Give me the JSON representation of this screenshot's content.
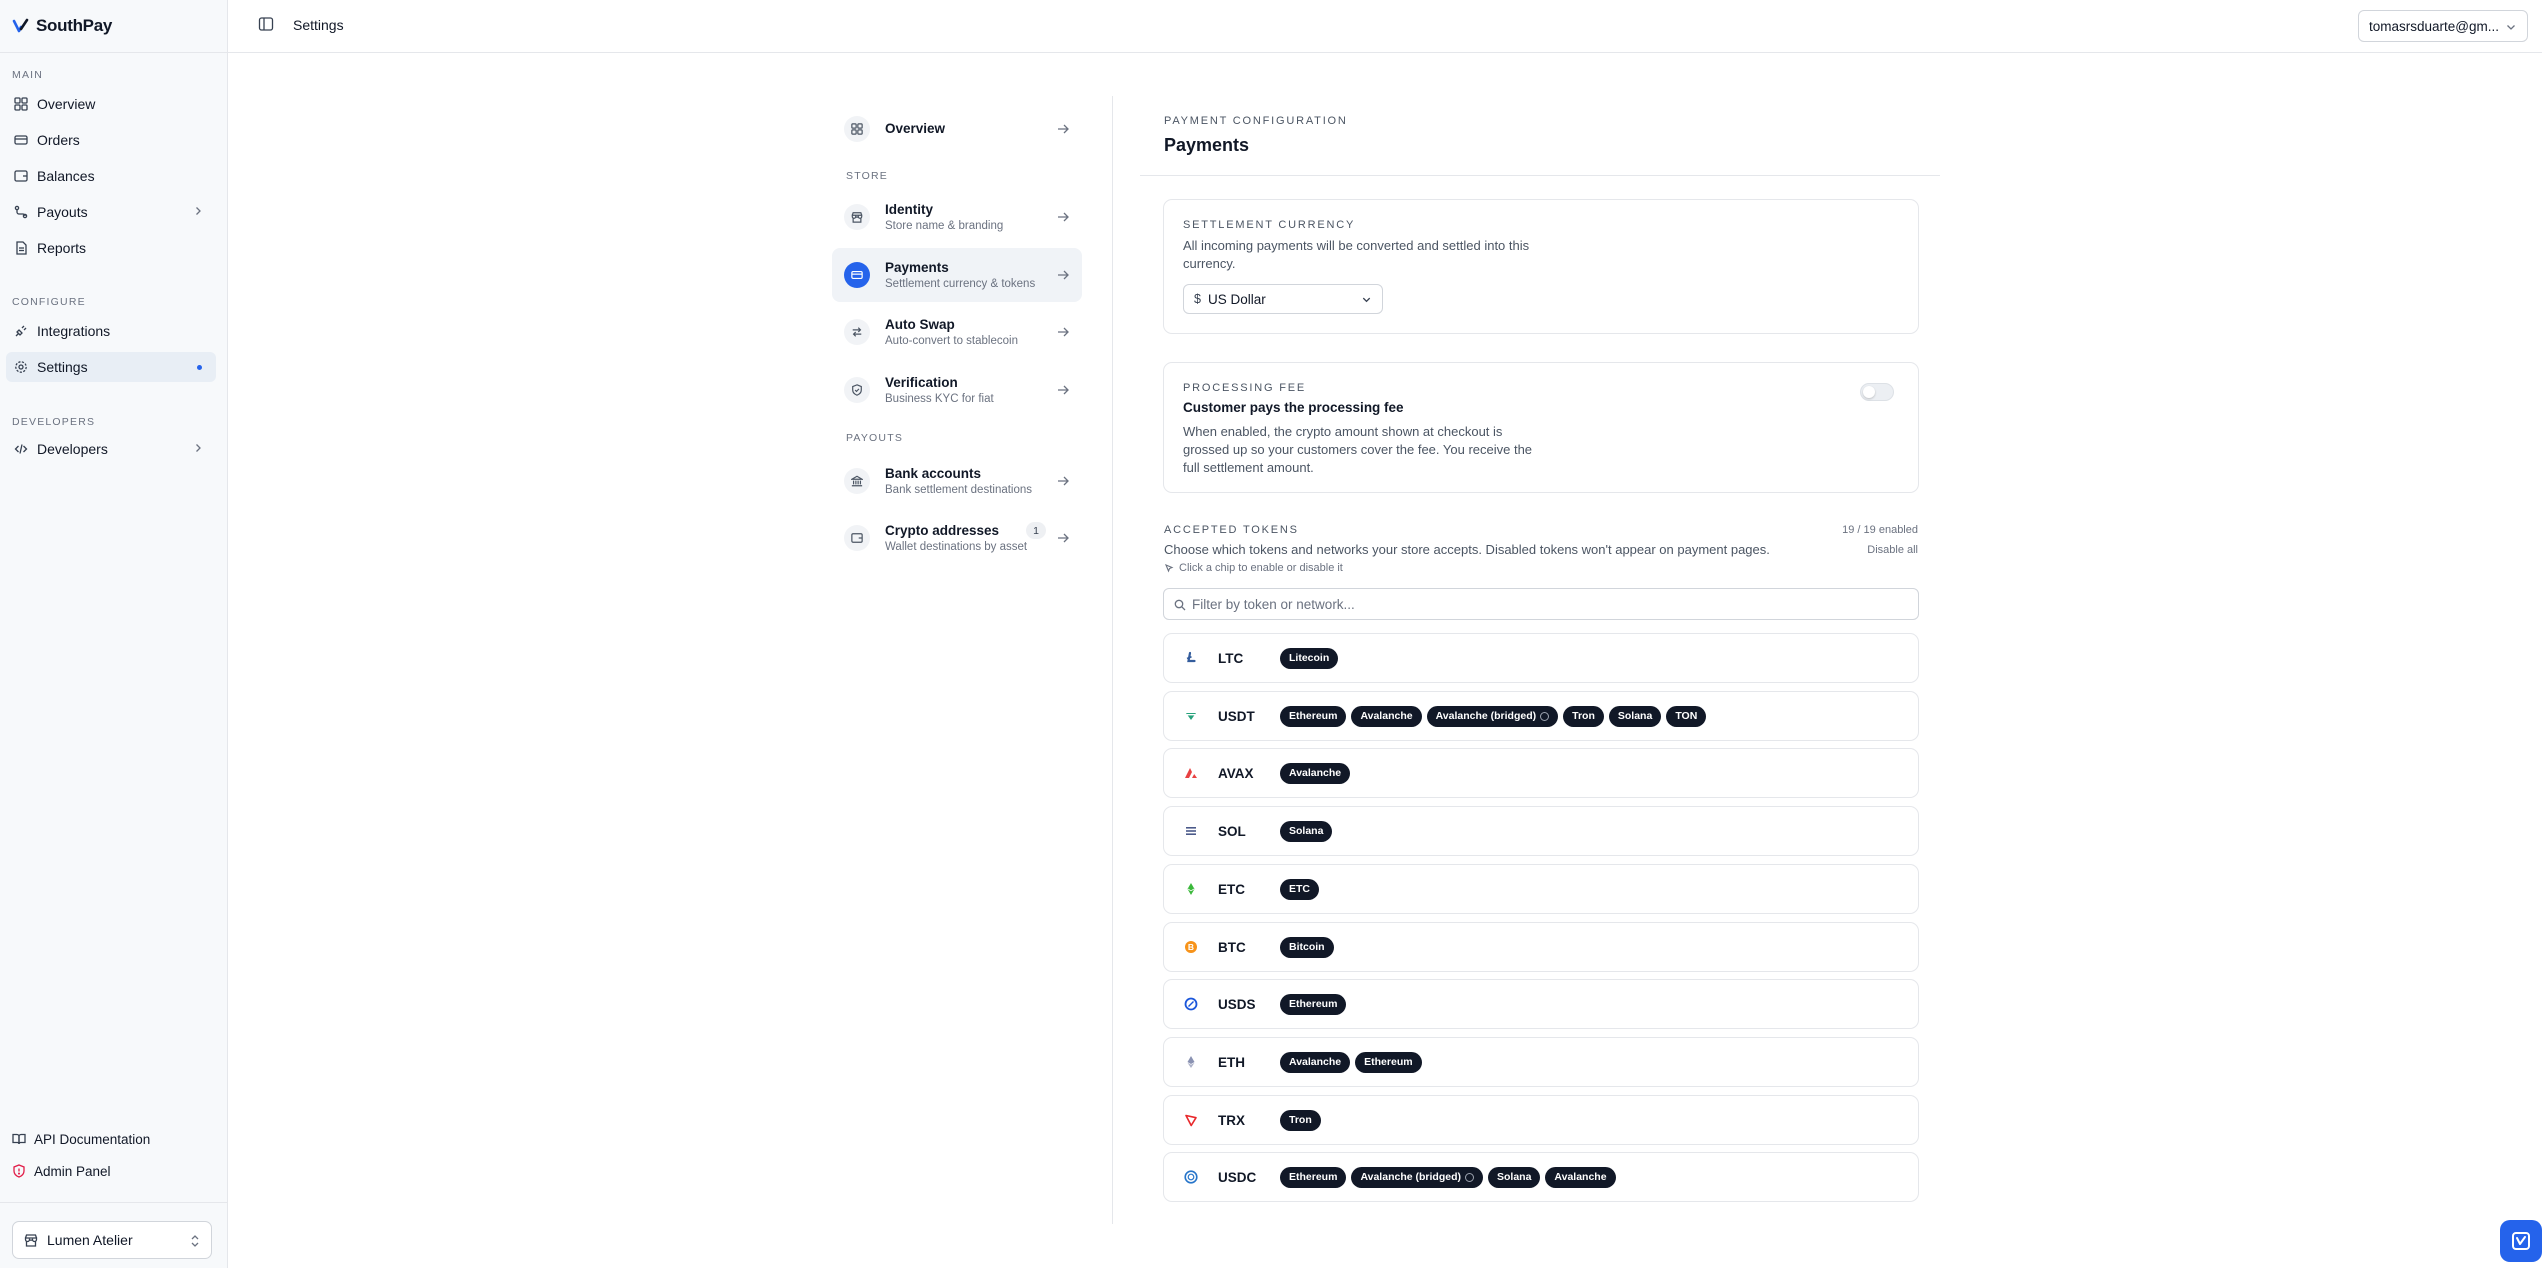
{
  "brand": {
    "name": "SouthPay"
  },
  "sidebar": {
    "sections": {
      "main": "MAIN",
      "configure": "CONFIGURE",
      "developers": "DEVELOPERS"
    },
    "items": [
      {
        "label": "Overview",
        "icon": "grid-icon"
      },
      {
        "label": "Orders",
        "icon": "card-icon"
      },
      {
        "label": "Balances",
        "icon": "wallet-icon"
      },
      {
        "label": "Payouts",
        "icon": "route-icon"
      },
      {
        "label": "Reports",
        "icon": "file-icon"
      },
      {
        "label": "Integrations",
        "icon": "plug-icon"
      },
      {
        "label": "Settings",
        "icon": "gear-icon"
      },
      {
        "label": "Developers",
        "icon": "code-icon"
      }
    ],
    "bottom": {
      "api_docs": "API Documentation",
      "admin_panel": "Admin Panel"
    },
    "store": "Lumen Atelier"
  },
  "topbar": {
    "breadcrumb": "Settings",
    "account": "tomasrsduarte@gm..."
  },
  "settings_nav": {
    "overview": "Overview",
    "store_label": "STORE",
    "payouts_label": "PAYOUTS",
    "items": [
      {
        "title": "Identity",
        "sub": "Store name & branding"
      },
      {
        "title": "Payments",
        "sub": "Settlement currency & tokens"
      },
      {
        "title": "Auto Swap",
        "sub": "Auto-convert to stablecoin"
      },
      {
        "title": "Verification",
        "sub": "Business KYC for fiat"
      },
      {
        "title": "Bank accounts",
        "sub": "Bank settlement destinations"
      },
      {
        "title": "Crypto addresses",
        "sub": "Wallet destinations by asset",
        "badge": "1"
      }
    ]
  },
  "main": {
    "kicker": "PAYMENT CONFIGURATION",
    "title": "Payments",
    "settlement": {
      "kicker": "SETTLEMENT CURRENCY",
      "desc": "All incoming payments will be converted and settled into this currency.",
      "symbol": "$",
      "value": "US Dollar"
    },
    "fee": {
      "kicker": "PROCESSING FEE",
      "title": "Customer pays the processing fee",
      "desc": "When enabled, the crypto amount shown at checkout is grossed up so your customers cover the fee. You receive the full settlement amount.",
      "enabled": false
    },
    "tokens": {
      "kicker": "ACCEPTED TOKENS",
      "count": "19 / 19 enabled",
      "desc": "Choose which tokens and networks your store accepts. Disabled tokens won't appear on payment pages.",
      "disable_all": "Disable all",
      "hint": "Click a chip to enable or disable it",
      "filter_placeholder": "Filter by token or network...",
      "rows": [
        {
          "symbol": "LTC",
          "icon": "litecoin-icon",
          "color": "#345d9d",
          "chips": [
            "Litecoin"
          ]
        },
        {
          "symbol": "USDT",
          "icon": "tether-icon",
          "color": "#26a17b",
          "chips": [
            "Ethereum",
            "Avalanche",
            "Avalanche (bridged)",
            "Tron",
            "Solana",
            "TON"
          ]
        },
        {
          "symbol": "AVAX",
          "icon": "avalanche-icon",
          "color": "#e84142",
          "chips": [
            "Avalanche"
          ]
        },
        {
          "symbol": "SOL",
          "icon": "solana-icon",
          "color": "#4b5a8a",
          "chips": [
            "Solana"
          ]
        },
        {
          "symbol": "ETC",
          "icon": "ethereum-classic-icon",
          "color": "#3ab83a",
          "chips": [
            "ETC"
          ]
        },
        {
          "symbol": "BTC",
          "icon": "bitcoin-icon",
          "color": "#f7931a",
          "chips": [
            "Bitcoin"
          ]
        },
        {
          "symbol": "USDS",
          "icon": "usds-icon",
          "color": "#1a56db",
          "chips": [
            "Ethereum"
          ]
        },
        {
          "symbol": "ETH",
          "icon": "ethereum-icon",
          "color": "#8a92b2",
          "chips": [
            "Avalanche",
            "Ethereum"
          ]
        },
        {
          "symbol": "TRX",
          "icon": "tron-icon",
          "color": "#e8282b",
          "chips": [
            "Tron"
          ]
        },
        {
          "symbol": "USDC",
          "icon": "usdc-icon",
          "color": "#2775ca",
          "chips": [
            "Ethereum",
            "Avalanche (bridged)",
            "Solana",
            "Avalanche"
          ]
        }
      ]
    }
  }
}
